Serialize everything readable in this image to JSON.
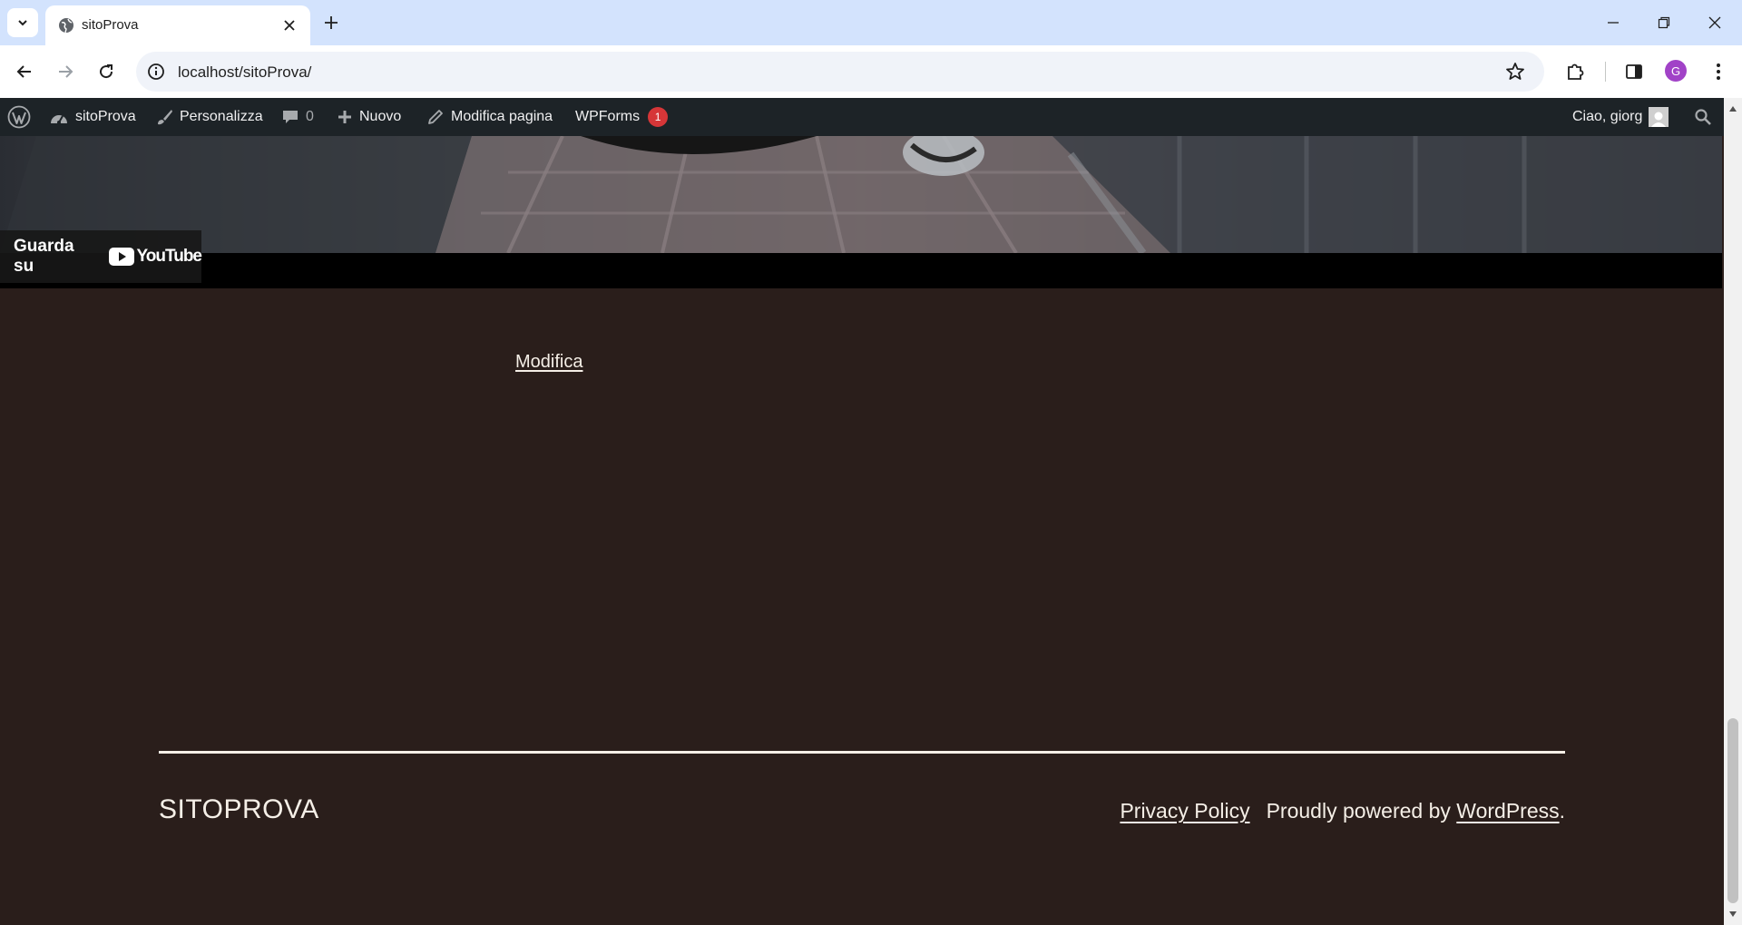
{
  "browser": {
    "tab_title": "sitoProva",
    "url": "localhost/sitoProva/",
    "profile_initial": "G"
  },
  "adminbar": {
    "site": "sitoProva",
    "customize": "Personalizza",
    "comments_count": "0",
    "new": "Nuovo",
    "edit_page": "Modifica pagina",
    "wpforms": "WPForms",
    "wpforms_badge": "1",
    "greeting": "Ciao, giorg"
  },
  "video": {
    "watch_on": "Guarda su",
    "youtube": "YouTube"
  },
  "content": {
    "edit_link": "Modifica"
  },
  "footer": {
    "site_name": "SITOPROVA",
    "privacy": "Privacy Policy",
    "powered_prefix": "Proudly powered by ",
    "wordpress": "WordPress",
    "powered_suffix": "."
  },
  "colors": {
    "page_background": "#2a1e1b",
    "admin_bar": "#1d2327",
    "text_light": "#f5efe7",
    "badge": "#d63638",
    "tabstrip": "#d3e3fd"
  }
}
